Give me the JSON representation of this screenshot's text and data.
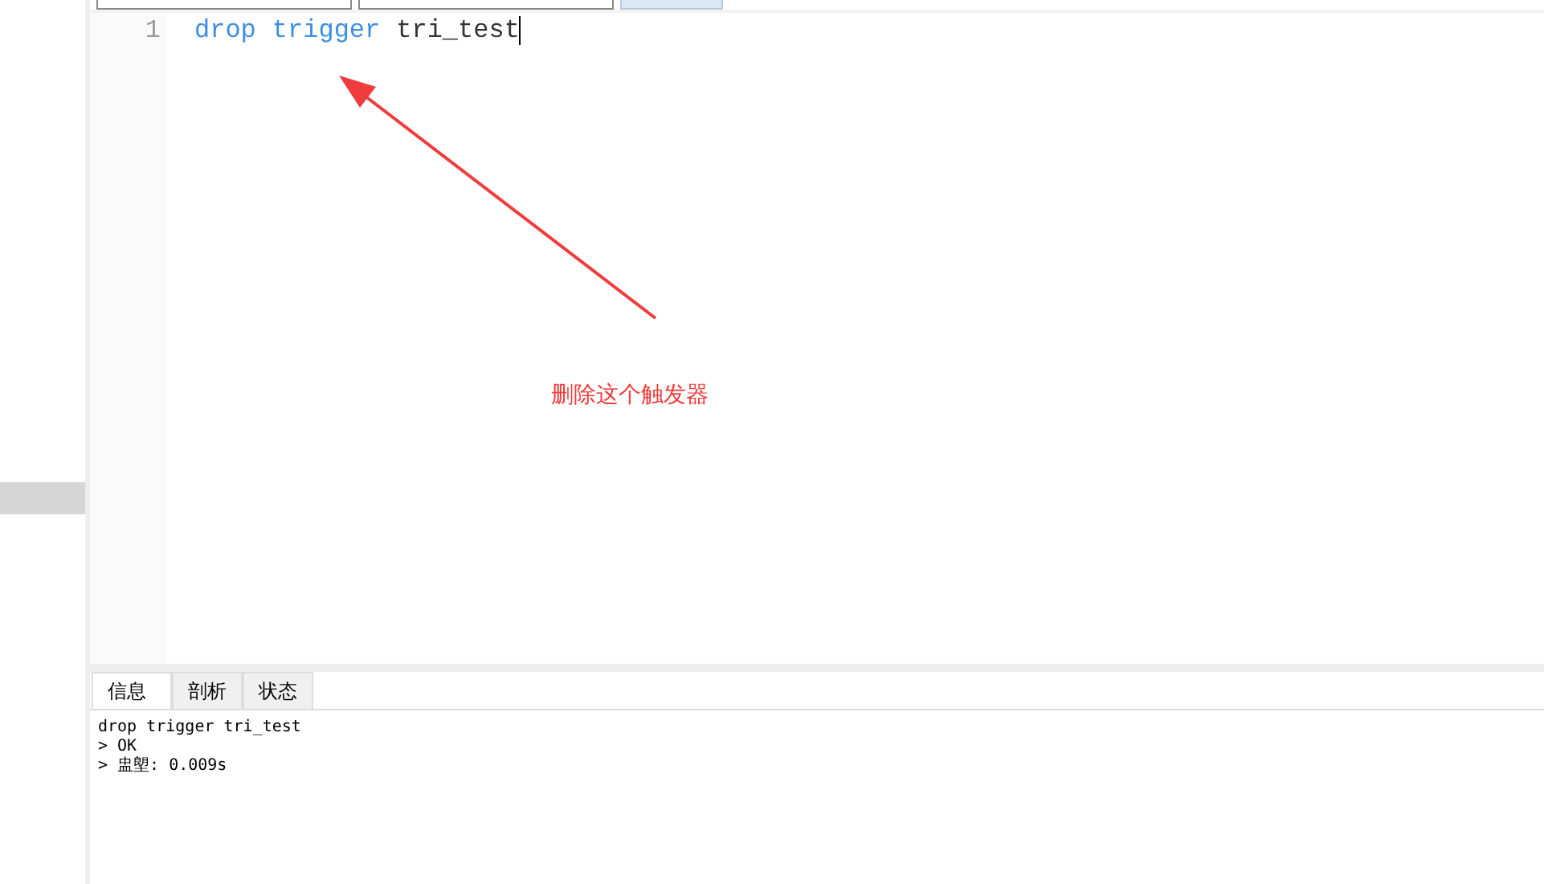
{
  "top_tabs": [
    {
      "selected": false
    },
    {
      "selected": false
    },
    {
      "selected": true
    }
  ],
  "editor": {
    "lines": [
      {
        "number": "1",
        "tokens": [
          {
            "text": "drop",
            "kind": "keyword"
          },
          {
            "text": "trigger",
            "kind": "keyword"
          },
          {
            "text": "tri_test",
            "kind": "plain"
          }
        ]
      }
    ]
  },
  "annotation": {
    "text": "删除这个触发器"
  },
  "result_panel": {
    "tabs": [
      {
        "label": "信息",
        "selected": true
      },
      {
        "label": "剖析",
        "selected": false
      },
      {
        "label": "状态",
        "selected": false
      }
    ],
    "messages": [
      "drop trigger tri_test",
      "> OK",
      "> 盅塱: 0.009s"
    ]
  }
}
